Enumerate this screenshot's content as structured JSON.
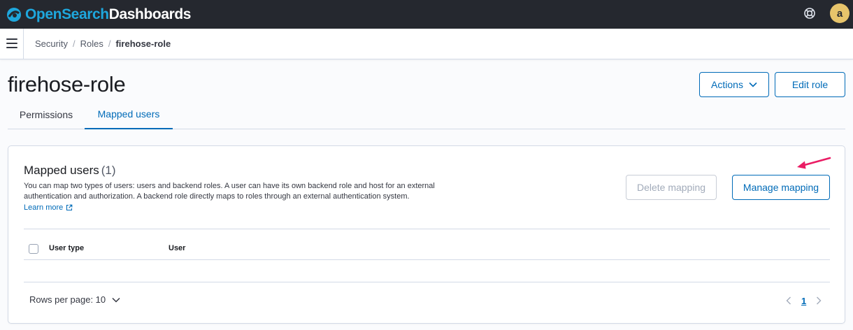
{
  "header": {
    "brand_part1": "OpenSearch",
    "brand_part2": "Dashboards",
    "avatar_initial": "a",
    "colors": {
      "bar": "#25282f",
      "accent": "#1ea7dd",
      "avatar": "#e7c46b"
    }
  },
  "breadcrumb": {
    "items": [
      "Security",
      "Roles",
      "firehose-role"
    ],
    "separator": "/"
  },
  "page": {
    "title": "firehose-role",
    "actions_label": "Actions",
    "edit_label": "Edit role"
  },
  "tabs": [
    {
      "label": "Permissions",
      "selected": false
    },
    {
      "label": "Mapped users",
      "selected": true
    }
  ],
  "panel": {
    "title": "Mapped users",
    "count": "(1)",
    "description": "You can map two types of users: users and backend roles. A user can have its own backend role and host for an external authentication and authorization. A backend role directly maps to roles through an external authentication system.",
    "learn_more": "Learn more",
    "delete_label": "Delete mapping",
    "manage_label": "Manage mapping",
    "columns": [
      "User type",
      "User"
    ],
    "rows_per_page": "Rows per page: 10",
    "current_page": "1"
  },
  "annotation": {
    "arrow_color": "#ea1c64"
  },
  "icons": {
    "logo": "opensearch-logo-icon",
    "help": "help-ring-icon",
    "menu": "hamburger-menu-icon",
    "external": "external-link-icon",
    "chevron": "chevron-down-icon"
  }
}
